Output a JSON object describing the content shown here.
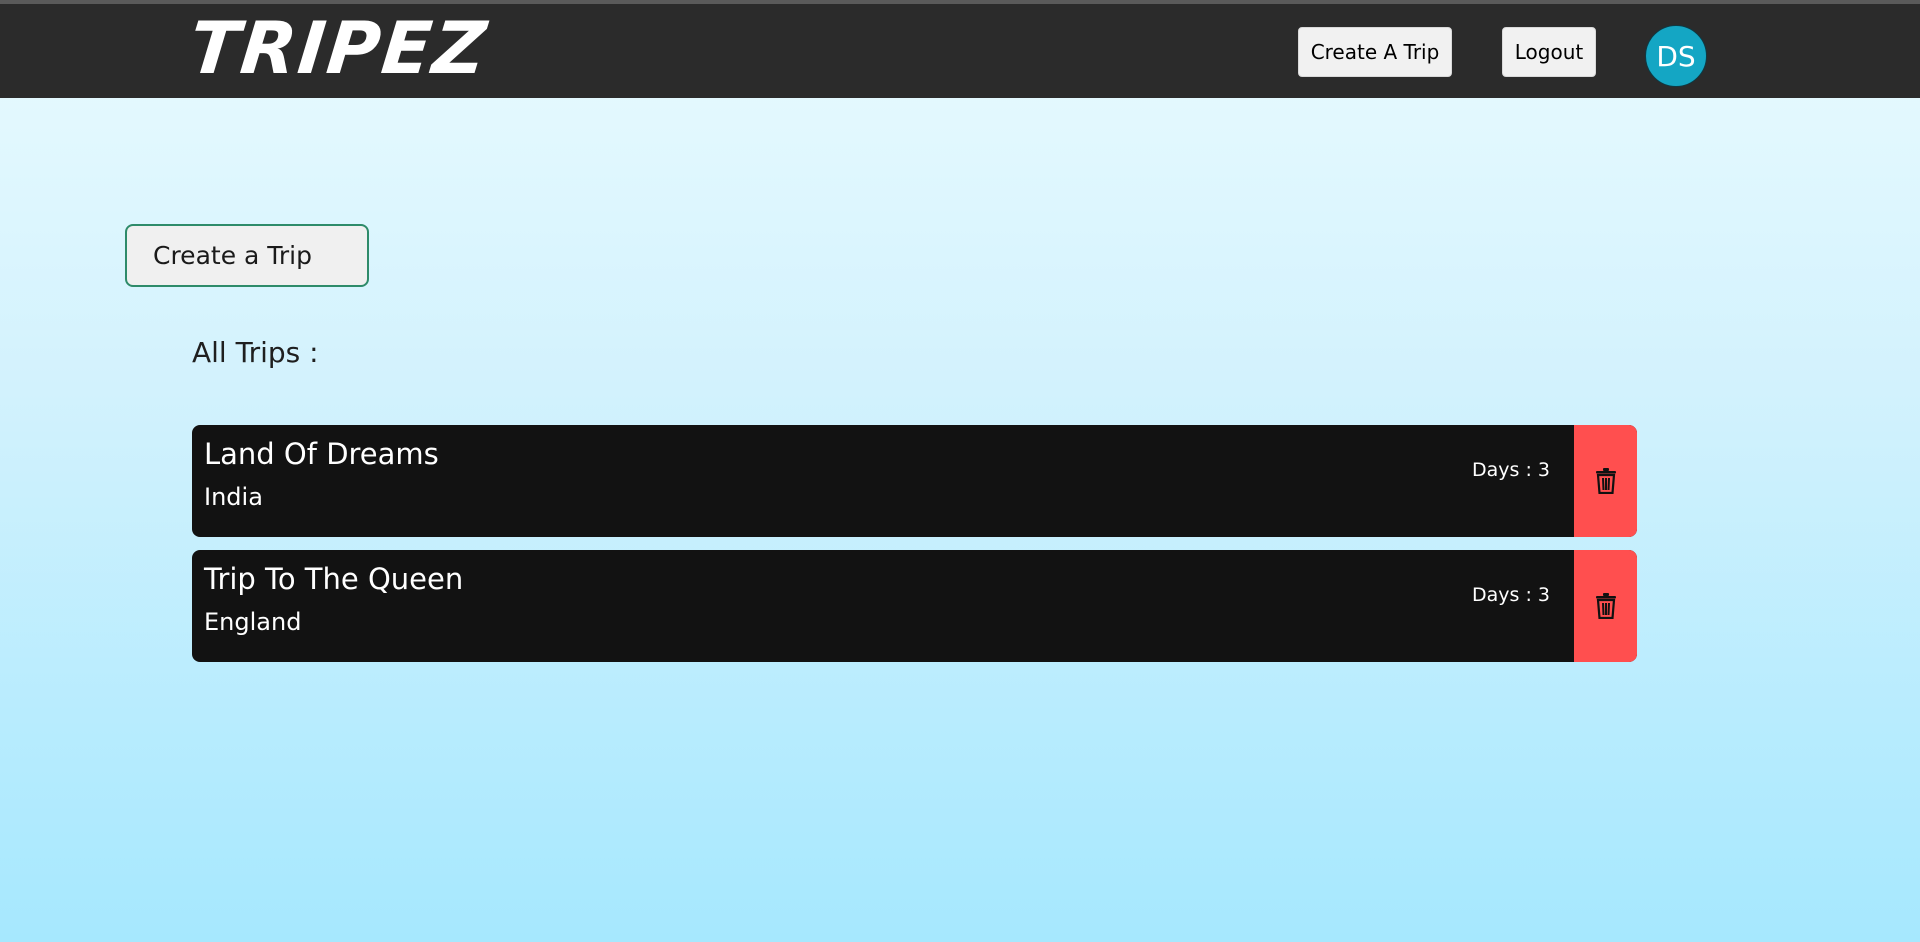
{
  "header": {
    "logo": "TRIPEZ",
    "create_trip_label": "Create A Trip",
    "logout_label": "Logout",
    "avatar_initials": "DS"
  },
  "main": {
    "create_trip_label": "Create a Trip",
    "section_title": "All Trips :",
    "trips": [
      {
        "name": "Land Of Dreams",
        "country": "India",
        "days": "Days : 3"
      },
      {
        "name": "Trip To The Queen",
        "country": "England",
        "days": "Days : 3"
      }
    ]
  },
  "colors": {
    "header_bg": "#2b2b2b",
    "card_bg": "#121212",
    "delete_bg": "#ff4f4f",
    "avatar_bg": "#14a6c4",
    "create_btn_border": "#2e8b6a"
  },
  "icons": {
    "delete": "trash-icon"
  }
}
